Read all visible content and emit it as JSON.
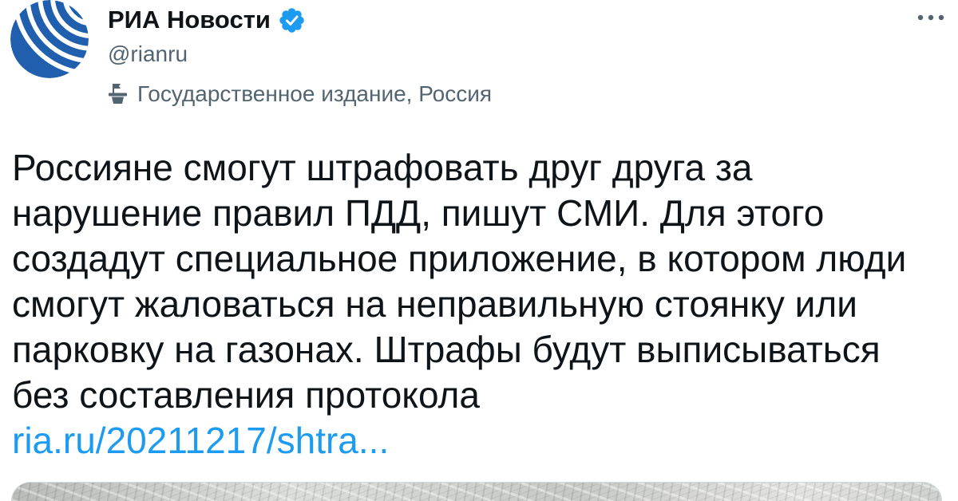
{
  "account": {
    "name": "РИА Новости",
    "handle": "@rianru",
    "verified": true,
    "label": "Государственное издание, Россия"
  },
  "tweet": {
    "text_lines": [
      "Россияне смогут штрафовать друг друга за",
      "нарушение правил ПДД, пишут СМИ. Для этого",
      "создадут специальное приложение, в котором люди",
      "смогут жаловаться на неправильную стоянку или",
      "парковку на газонах. Штрафы будут выписываться",
      "без составления протокола"
    ],
    "link": "ria.ru/20211217/shtra..."
  },
  "icons": {
    "avatar": "ria-novosti-logo",
    "verified": "verified-badge-icon",
    "label": "state-media-icon",
    "more": "more-options-icon"
  },
  "colors": {
    "text": "#0f1419",
    "secondary": "#536471",
    "link": "#1d9bf0",
    "verified": "#1d9bf0",
    "avatar": "#1f5fae",
    "border": "#cfd9de"
  }
}
